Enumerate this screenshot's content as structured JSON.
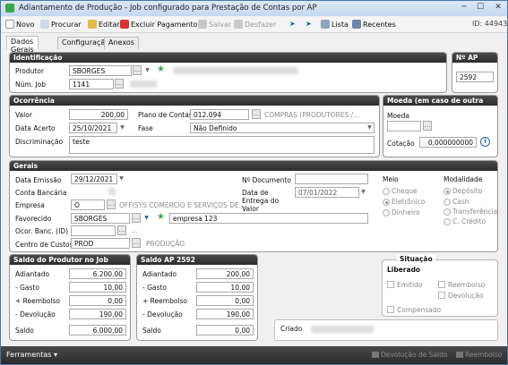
{
  "window": {
    "title": "Adiantamento de Produção - Job configurado para Prestação de Contas por AP"
  },
  "toolbar": {
    "novo": "Novo",
    "procurar": "Procurar",
    "editar": "Editar",
    "excluir": "Excluir Pagamento",
    "salvar": "Salvar",
    "desfazer": "Desfazer",
    "lista": "Lista",
    "recentes": "Recentes",
    "id_label": "ID: 44943"
  },
  "tabs": {
    "dados": "Dados Gerais",
    "config": "Configuração",
    "anexos": "Anexos"
  },
  "identificacao": {
    "header": "Identificação",
    "produtor_label": "Produtor",
    "produtor": "SBORGES",
    "num_job_label": "Núm. Job",
    "num_job": "1141"
  },
  "nap": {
    "header": "Nº AP",
    "value": "2592"
  },
  "ocorrencia": {
    "header": "Ocorrência",
    "valor_label": "Valor",
    "valor": "200,00",
    "plano_label": "Plano de Contas",
    "plano_code": "012.094",
    "plano_desc": "COMPRAS (PRODUTORES /...",
    "data_label": "Data Acerto",
    "data": "25/10/2021",
    "fase_label": "Fase",
    "fase": "Não Definido",
    "discr_label": "Discriminação",
    "discr": "teste"
  },
  "moeda": {
    "header": "Moeda (em caso de outra moeda)",
    "moeda_label": "Moeda",
    "cotacao_label": "Cotação",
    "cotacao": "0,000000000"
  },
  "gerais": {
    "header": "Gerais",
    "emissao_label": "Data Emissão",
    "emissao": "29/12/2021",
    "conta_label": "Conta Bancária",
    "empresa_label": "Empresa",
    "empresa_code": "O",
    "empresa_desc": "OFFISYS COMÉRCIO E SERVIÇOS DE...",
    "fav_label": "Favorecido",
    "fav": "SBORGES",
    "fav_desc": "empresa 123",
    "ocor_label": "Ocor. Banc. (ID)",
    "ocor_sep": "...",
    "cc_label": "Centro de Custos",
    "cc": "PROD",
    "cc_desc": "PRODUÇÃO",
    "ndoc_label": "Nº Documento",
    "entrega_label": "Data de Entrega do Valor",
    "entrega": "07/01/2022",
    "meio_label": "Meio",
    "meio": [
      "Cheque",
      "Eletrônico",
      "Dinheiro"
    ],
    "mod_label": "Modalidade",
    "mod": [
      "Depósito",
      "Cash",
      "Transferência",
      "C. Crédito"
    ]
  },
  "saldo_prod": {
    "header": "Saldo do Produtor no Job",
    "rows": [
      {
        "label": "Adiantado",
        "value": "6.200,00"
      },
      {
        "label": "- Gasto",
        "value": "10,00"
      },
      {
        "label": "+ Reembolso",
        "value": "0,00"
      },
      {
        "label": "- Devolução",
        "value": "190,00"
      },
      {
        "label": "Saldo",
        "value": "6.000,00"
      }
    ]
  },
  "saldo_ap": {
    "header": "Saldo AP 2592",
    "rows": [
      {
        "label": "Adiantado",
        "value": "200,00"
      },
      {
        "label": "- Gasto",
        "value": "10,00"
      },
      {
        "label": "+ Reembolso",
        "value": "0,00"
      },
      {
        "label": "- Devolução",
        "value": "190,00"
      },
      {
        "label": "Saldo",
        "value": "0,00"
      }
    ]
  },
  "situacao": {
    "header": "Situação",
    "status": "Liberado",
    "emitido": "Emitido",
    "reembolso": "Reembolso",
    "devolucao": "Devolução",
    "compensado": "Compensado"
  },
  "criado": {
    "label": "Criado"
  },
  "status": {
    "ferramentas": "Ferramentas",
    "devolucao": "Devolução de Saldo",
    "reembolso": "Reembolso"
  },
  "colors": {
    "accent": "#1f5fb0",
    "header_bg": "#333333",
    "status_bg": "#3a3a3a"
  }
}
